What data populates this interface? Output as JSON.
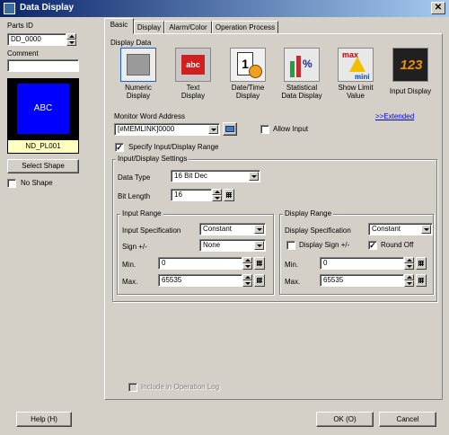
{
  "window": {
    "title": "Data Display"
  },
  "left": {
    "parts_id_label": "Parts ID",
    "parts_id_value": "DD_0000",
    "comment_label": "Comment",
    "comment_value": "",
    "preview_text": "ABC",
    "preview_name": "ND_PL001",
    "select_shape_label": "Select Shape",
    "no_shape_label": "No Shape"
  },
  "tabs": [
    "Basic",
    "Display",
    "Alarm/Color",
    "Operation Process"
  ],
  "display_data": {
    "label": "Display Data",
    "types": [
      {
        "label1": "Numeric",
        "label2": "Display"
      },
      {
        "label1": "Text",
        "label2": "Display"
      },
      {
        "label1": "Date/Time",
        "label2": "Display"
      },
      {
        "label1": "Statistical",
        "label2": "Data Display"
      },
      {
        "label1": "Show Limit",
        "label2": "Value"
      },
      {
        "label1": "Input Display",
        "label2": ""
      }
    ],
    "icon_text": {
      "text": "abc",
      "maxmin1": "max",
      "maxmin2": "mini",
      "digits": "123"
    }
  },
  "monitor": {
    "label": "Monitor Word Address",
    "value": "[#MEMLINK]0000",
    "extended_link": ">>Extended",
    "allow_input_label": "Allow Input",
    "specify_range_label": "Specify Input/Display Range"
  },
  "settings": {
    "legend": "Input/Display Settings",
    "data_type_label": "Data Type",
    "data_type_value": "16 Bit Dec",
    "bit_length_label": "Bit Length",
    "bit_length_value": "16"
  },
  "input_range": {
    "legend": "Input Range",
    "spec_label": "Input Specification",
    "spec_value": "Constant",
    "sign_label": "Sign +/-",
    "sign_value": "None",
    "min_label": "Min.",
    "min_value": "0",
    "max_label": "Max.",
    "max_value": "65535"
  },
  "display_range": {
    "legend": "Display Range",
    "spec_label": "Display Specification",
    "spec_value": "Constant",
    "sign_label": "Display Sign +/-",
    "round_off_label": "Round Off",
    "min_label": "Min.",
    "min_value": "0",
    "max_label": "Max.",
    "max_value": "65535"
  },
  "operation_log_label": "Include in Operation Log",
  "footer": {
    "help_label": "Help (H)",
    "ok_label": "OK (O)",
    "cancel_label": "Cancel"
  },
  "colors": {
    "title_start": "#0a246a",
    "title_end": "#a6caf0",
    "preview_bg": "#0000ff",
    "preview_label_bg": "#ffffc0",
    "link": "#0000ff"
  }
}
